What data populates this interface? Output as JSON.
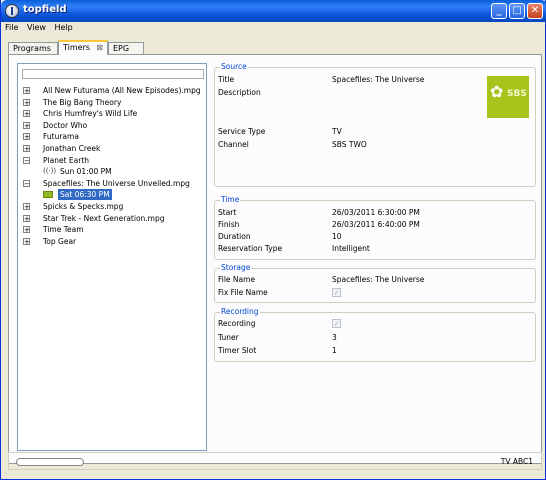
{
  "window": {
    "title": "topfield"
  },
  "menu": [
    "File",
    "View",
    "Help"
  ],
  "tabs": [
    {
      "label": "Programs"
    },
    {
      "label": "Timers",
      "close": "⊠",
      "active": true
    },
    {
      "label": "EPG"
    }
  ],
  "tree": {
    "items": [
      {
        "label": "All New Futurama (All New Episodes).mpg",
        "expander": "+"
      },
      {
        "label": "The Big Bang Theory",
        "expander": "+"
      },
      {
        "label": "Chris Humfrey's Wild Life",
        "expander": "+"
      },
      {
        "label": "Doctor Who",
        "expander": "+"
      },
      {
        "label": "Futurama",
        "expander": "+"
      },
      {
        "label": "Jonathan Creek",
        "expander": "+"
      },
      {
        "label": "Planet Earth",
        "expander": "−"
      },
      {
        "label": "Sun 01:00 PM",
        "child": true
      },
      {
        "label": "Spacefiles: The Universe Unveiled.mpg",
        "expander": "−"
      },
      {
        "label": "Sat 06:30 PM",
        "child": true,
        "selected": true
      },
      {
        "label": "Spicks & Specks.mpg",
        "expander": "+"
      },
      {
        "label": "Star Trek - Next Generation.mpg",
        "expander": "+"
      },
      {
        "label": "Time Team",
        "expander": "+"
      },
      {
        "label": "Top Gear",
        "expander": "+"
      }
    ]
  },
  "source": {
    "heading": "Source",
    "title_label": "Title",
    "title_value": "Spacefiles: The Universe",
    "description_label": "Description",
    "service_type_label": "Service Type",
    "service_type_value": "TV",
    "channel_label": "Channel",
    "channel_value": "SBS TWO",
    "logo_text": "SBS"
  },
  "time": {
    "heading": "Time",
    "start_label": "Start",
    "start_value": "26/03/2011 6:30:00 PM",
    "finish_label": "Finish",
    "finish_value": "26/03/2011 6:40:00 PM",
    "duration_label": "Duration",
    "duration_value": "10",
    "reservation_label": "Reservation Type",
    "reservation_value": "Intelligent"
  },
  "storage": {
    "heading": "Storage",
    "file_name_label": "File Name",
    "file_name_value": "Spacefiles: The Universe",
    "fix_file_name_label": "Fix File Name",
    "fix_file_name_checked": true
  },
  "recording": {
    "heading": "Recording",
    "recording_label": "Recording",
    "recording_checked": true,
    "tuner_label": "Tuner",
    "tuner_value": "3",
    "timer_slot_label": "Timer Slot",
    "timer_slot_value": "1"
  },
  "status": {
    "text": "TV ABC1"
  }
}
